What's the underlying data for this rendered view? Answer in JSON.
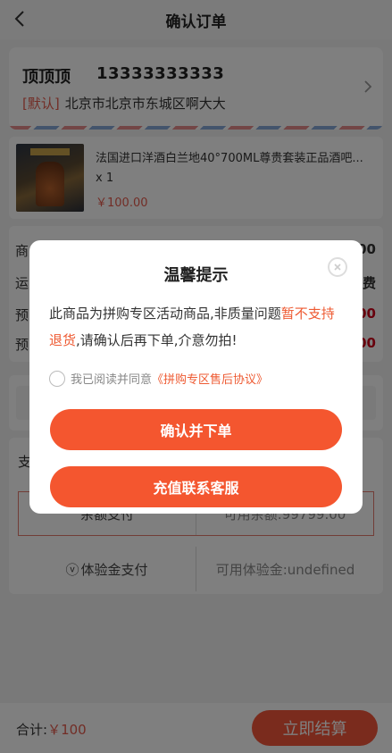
{
  "header": {
    "title": "确认订单"
  },
  "address": {
    "name": "顶顶顶",
    "phone": "13333333333",
    "default_tag": "[默认]",
    "address_text": "北京市北京市东城区啊大大"
  },
  "product": {
    "title": "法国进口洋酒白兰地40°700ML尊贵套装正品酒吧...",
    "quantity": "x 1",
    "price": "￥100.00"
  },
  "summary": {
    "rows": [
      {
        "label": "商",
        "value": "00"
      },
      {
        "label": "运",
        "value": "费"
      },
      {
        "label": "预",
        "value": "00"
      },
      {
        "label": "预",
        "value": "00"
      }
    ]
  },
  "payment": {
    "label": "支",
    "options": [
      {
        "name": "余额支付",
        "balance": "可用余额:99799.00"
      },
      {
        "name": "体验金支付",
        "balance": "可用体验金:undefined"
      }
    ]
  },
  "bottom": {
    "total_label": "合计:",
    "total_value": "￥100",
    "submit_label": "立即结算"
  },
  "modal": {
    "title": "温馨提示",
    "message_part1": "此商品为拼购专区活动商品,非质量问题",
    "message_highlight": "暂不支持退货",
    "message_part2": ",请确认后再下单,介意勿拍!",
    "agree_text": "我已阅读并同意",
    "agree_link": "《拼购专区售后协议》",
    "confirm_label": "确认并下单",
    "service_label": "充值联系客服"
  },
  "colors": {
    "accent": "#f4562f",
    "price": "#e55b4d"
  }
}
